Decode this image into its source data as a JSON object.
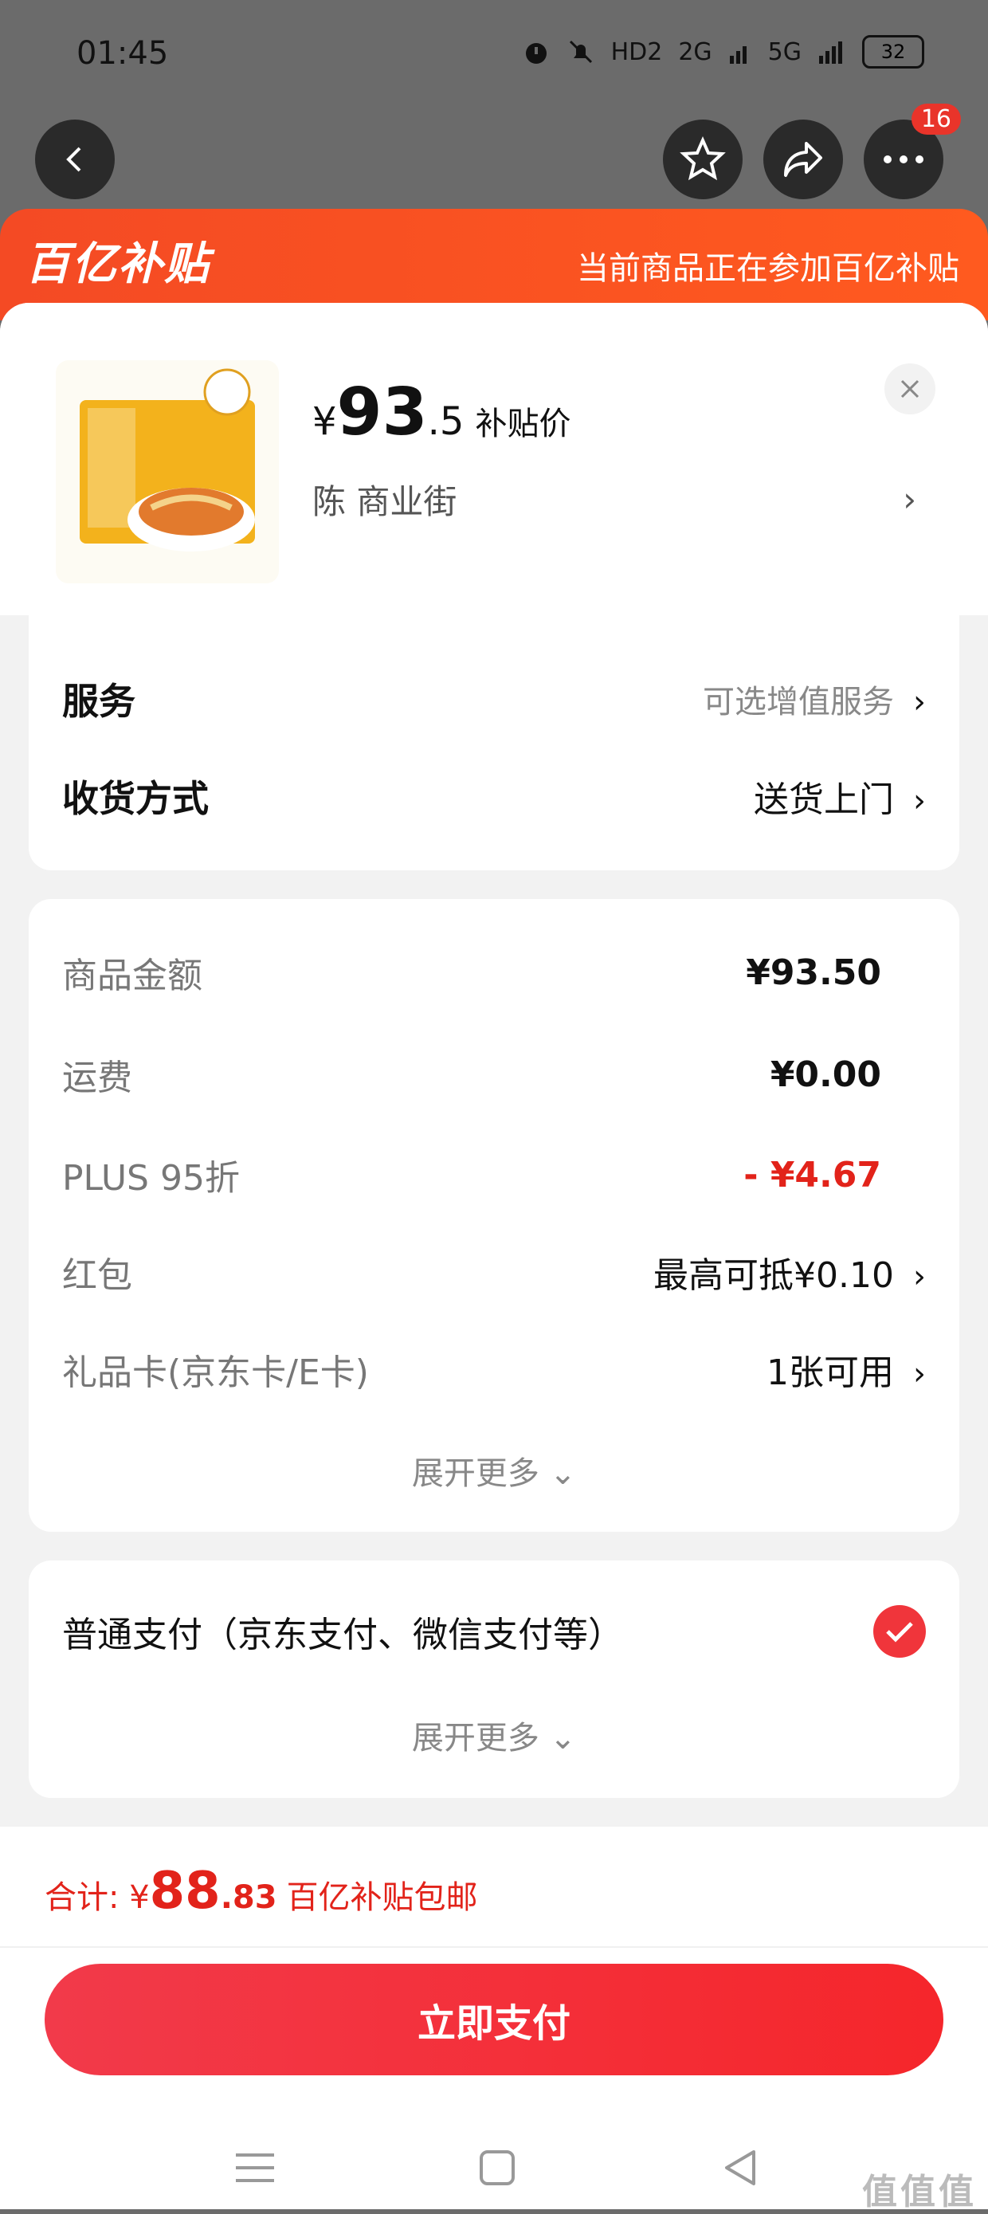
{
  "status_bar": {
    "time": "01:45",
    "battery": "32",
    "network_labels": [
      "HD2",
      "2G",
      "5G"
    ]
  },
  "top_nav": {
    "cart_badge": "16"
  },
  "promo_banner": {
    "logo": "百亿补贴",
    "text": "当前商品正在参加百亿补贴"
  },
  "product": {
    "price_symbol": "¥",
    "price_int": "93",
    "price_dec": ".5",
    "price_tag": "补贴价",
    "shop": "陈  商业街"
  },
  "options": {
    "service_label": "服务",
    "service_value": "可选增值服务",
    "delivery_label": "收货方式",
    "delivery_value": "送货上门"
  },
  "summary": {
    "goods_label": "商品金额",
    "goods_value": "¥93.50",
    "shipping_label": "运费",
    "shipping_value": "¥0.00",
    "plus_label": "PLUS 95折",
    "plus_value": "- ¥4.67",
    "redpacket_label": "红包",
    "redpacket_value": "最高可抵¥0.10",
    "giftcard_label": "礼品卡(京东卡/E卡)",
    "giftcard_value": "1张可用",
    "expand": "展开更多 ⌄"
  },
  "payment": {
    "method_label": "普通支付（京东支付、微信支付等）",
    "expand": "展开更多 ⌄"
  },
  "footer": {
    "total_prefix": "合计: ¥",
    "total_int": "88",
    "total_dec": ".83",
    "total_note": "百亿补贴包邮",
    "pay_button": "立即支付"
  },
  "watermark": "值值值"
}
